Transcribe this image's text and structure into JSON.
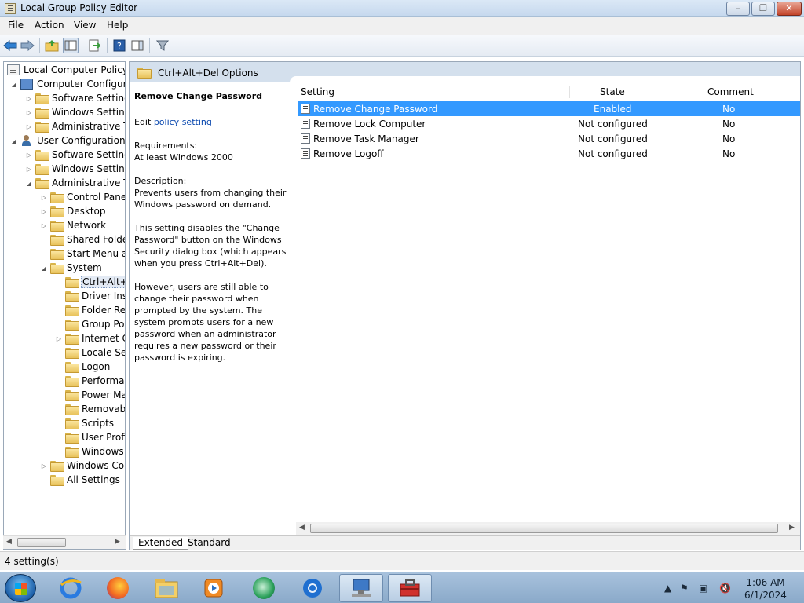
{
  "window": {
    "title": "Local Group Policy Editor",
    "min_label": "–",
    "max_label": "❐",
    "close_label": "✕"
  },
  "menu": [
    "File",
    "Action",
    "View",
    "Help"
  ],
  "toolbar": {
    "icons": [
      "back-arrow-icon",
      "forward-arrow-icon",
      "up-folder-icon",
      "show-hide-tree-icon",
      "export-list-icon",
      "help-icon",
      "show-hide-action-pane-icon",
      "filter-icon"
    ]
  },
  "tree": {
    "items": [
      {
        "label": "Local Computer Policy",
        "icon": "document"
      },
      {
        "label": "Computer Configura",
        "icon": "computer"
      },
      {
        "label": "Software Settings",
        "icon": "folder"
      },
      {
        "label": "Windows Setting",
        "icon": "folder"
      },
      {
        "label": "Administrative Te",
        "icon": "folder"
      },
      {
        "label": "User Configuration",
        "icon": "user"
      },
      {
        "label": "Software Settings",
        "icon": "folder"
      },
      {
        "label": "Windows Setting",
        "icon": "folder"
      },
      {
        "label": "Administrative Te",
        "icon": "folder"
      },
      {
        "label": "Control Panel",
        "icon": "folder"
      },
      {
        "label": "Desktop",
        "icon": "folder"
      },
      {
        "label": "Network",
        "icon": "folder"
      },
      {
        "label": "Shared Folder",
        "icon": "folder"
      },
      {
        "label": "Start Menu ar",
        "icon": "folder"
      },
      {
        "label": "System",
        "icon": "folder"
      },
      {
        "label": "Ctrl+Alt+I",
        "icon": "folder",
        "selected": true
      },
      {
        "label": "Driver Inst",
        "icon": "folder"
      },
      {
        "label": "Folder Rec",
        "icon": "folder"
      },
      {
        "label": "Group Pol",
        "icon": "folder"
      },
      {
        "label": "Internet C",
        "icon": "folder"
      },
      {
        "label": "Locale Ser",
        "icon": "folder"
      },
      {
        "label": "Logon",
        "icon": "folder"
      },
      {
        "label": "Performar",
        "icon": "folder"
      },
      {
        "label": "Power Ma",
        "icon": "folder"
      },
      {
        "label": "Removabl",
        "icon": "folder"
      },
      {
        "label": "Scripts",
        "icon": "folder"
      },
      {
        "label": "User Profi",
        "icon": "folder"
      },
      {
        "label": "Windows",
        "icon": "folder"
      },
      {
        "label": "Windows Cor",
        "icon": "folder"
      },
      {
        "label": "All Settings",
        "icon": "folder"
      }
    ]
  },
  "breadcrumb": "Ctrl+Alt+Del Options",
  "description": {
    "title": "Remove Change Password",
    "edit_prefix": "Edit ",
    "edit_link": "policy setting",
    "requirements_label": "Requirements:",
    "requirements_value": "At least Windows 2000",
    "description_label": "Description:",
    "para1": "Prevents users from changing their Windows password on demand.",
    "para2": "This setting disables the \"Change Password\" button on the Windows Security dialog box (which appears when you press Ctrl+Alt+Del).",
    "para3": "However, users are still able to change their password when prompted by the system. The system prompts users for a new password when an administrator requires a new password or their password is expiring."
  },
  "list": {
    "columns": {
      "setting": "Setting",
      "state": "State",
      "comment": "Comment"
    },
    "rows": [
      {
        "setting": "Remove Change Password",
        "state": "Enabled",
        "comment": "No",
        "selected": true
      },
      {
        "setting": "Remove Lock Computer",
        "state": "Not configured",
        "comment": "No"
      },
      {
        "setting": "Remove Task Manager",
        "state": "Not configured",
        "comment": "No"
      },
      {
        "setting": "Remove Logoff",
        "state": "Not configured",
        "comment": "No"
      }
    ]
  },
  "tabs": {
    "extended": "Extended",
    "standard": "Standard"
  },
  "status": "4 setting(s)",
  "taskbar": {
    "apps": [
      "internet-explorer-icon",
      "firefox-icon",
      "file-explorer-icon",
      "media-player-icon",
      "chat-app-icon",
      "chrome-icon",
      "network-app-icon",
      "toolbox-app-icon"
    ],
    "clock_time": "1:06 AM",
    "clock_date": "6/1/2024"
  },
  "colors": {
    "selection": "#3399ff",
    "breadcrumb_bg": "#d4e0ed",
    "link": "#0645ad"
  }
}
